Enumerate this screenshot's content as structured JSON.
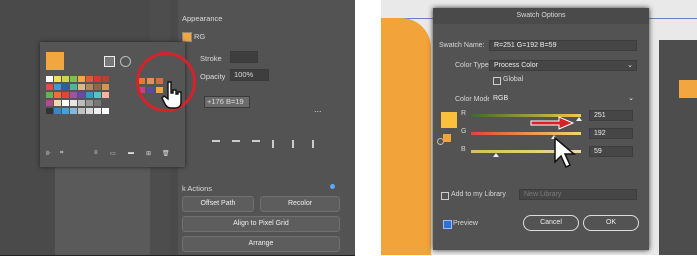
{
  "left": {
    "appearance_title": "Appearance",
    "fill_mode": "RG",
    "stroke_label": "Stroke",
    "opacity_label": "Opacity",
    "opacity_value": "100%",
    "color_readout": "+176 B=19",
    "quick_actions_title": "k Actions",
    "buttons": [
      "Offset Path",
      "Recolor",
      "Align to Pixel Grid",
      "Arrange"
    ],
    "more_dots": "...",
    "swatch_colors": {
      "row1": [
        "#ffffff",
        "#f2e14b",
        "#c7d94a",
        "#7dbf55",
        "#f6a543",
        "#e05a3a",
        "#d6392f",
        "#b2432f"
      ],
      "row2": [
        "#e7465a",
        "#3d9bd8",
        "#2a5fa8",
        "#4ab69b",
        "#d7b98e",
        "#b08a5c",
        "#8a6a40",
        "#cf9a4c"
      ],
      "row3": [
        "#64b15a",
        "#ef6b3c",
        "#e4423f",
        "#9b56a1",
        "#6a4aa0",
        "#2fa0b9",
        "#57c0c8",
        "#f4b0a9"
      ],
      "row4": [
        "#b34a8c",
        "#f6d6b6",
        "#ffffff",
        "#e6e6e6",
        "#bdbdbd",
        "#9a9a9a",
        "#777777",
        "#555555"
      ],
      "row5": [
        "#333333",
        "#3d83c7",
        "#46a1d6",
        "#86b8dc",
        "#c2c2c2",
        "#dadada",
        "#efefef",
        "#ffffff"
      ]
    },
    "highlight_swatches": [
      "#f0752e",
      "#e88d5c",
      "#d86c3c",
      "#c43f8d",
      "#5b4aa0",
      "#f2a640"
    ]
  },
  "dialog": {
    "title": "Swatch Options",
    "swatch_name_label": "Swatch Name:",
    "swatch_name_value": "R=251 G=192 B=59",
    "color_type_label": "Color Type:",
    "color_type_value": "Process Color",
    "global_label": "Global",
    "color_mode_label": "Color Mode:",
    "color_mode_value": "RGB",
    "channels": [
      {
        "label": "R",
        "value": "251",
        "level": 0.98
      },
      {
        "label": "G",
        "value": "192",
        "level": 0.75
      },
      {
        "label": "B",
        "value": "59",
        "level": 0.23
      }
    ],
    "add_library_label": "Add to my Library",
    "library_placeholder": "New Library",
    "preview_label": "Preview",
    "cancel_label": "Cancel",
    "ok_label": "OK",
    "swatch_color": "#fbc03b"
  }
}
